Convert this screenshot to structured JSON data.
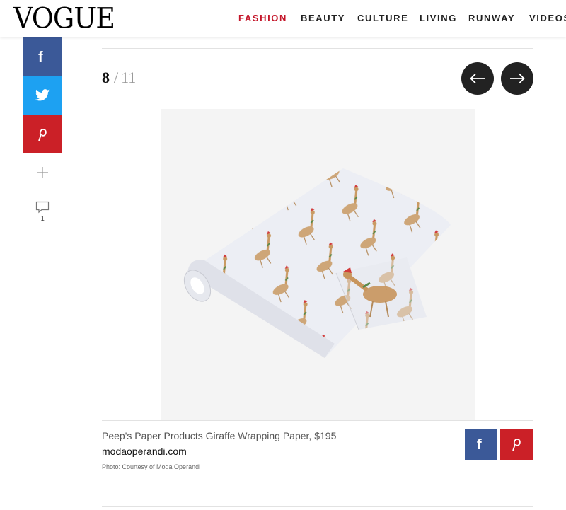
{
  "header": {
    "logo": "VOGUE",
    "nav": [
      {
        "label": "FASHION",
        "active": true
      },
      {
        "label": "BEAUTY",
        "active": false
      },
      {
        "label": "CULTURE",
        "active": false
      },
      {
        "label": "LIVING",
        "active": false
      },
      {
        "label": "RUNWAY",
        "active": false
      },
      {
        "label": "VIDEOS",
        "active": false
      }
    ]
  },
  "social_sidebar": {
    "facebook_icon": "facebook-icon",
    "twitter_icon": "twitter-icon",
    "pinterest_icon": "pinterest-icon",
    "more_icon": "plus-icon",
    "comment_icon": "comment-icon",
    "comment_count": "1"
  },
  "slideshow": {
    "current": "8",
    "separator": "/",
    "total": "11",
    "prev_icon": "arrow-left-icon",
    "next_icon": "arrow-right-icon"
  },
  "item": {
    "caption": "Peep's Paper Products Giraffe Wrapping Paper, $195",
    "link": "modaoperandi.com",
    "credit": "Photo: Courtesy of Moda Operandi",
    "share": [
      "facebook-icon",
      "pinterest-icon"
    ]
  },
  "colors": {
    "accent": "#c4162a",
    "facebook": "#3b5998",
    "twitter": "#1da1f2",
    "pinterest": "#cb2027"
  }
}
